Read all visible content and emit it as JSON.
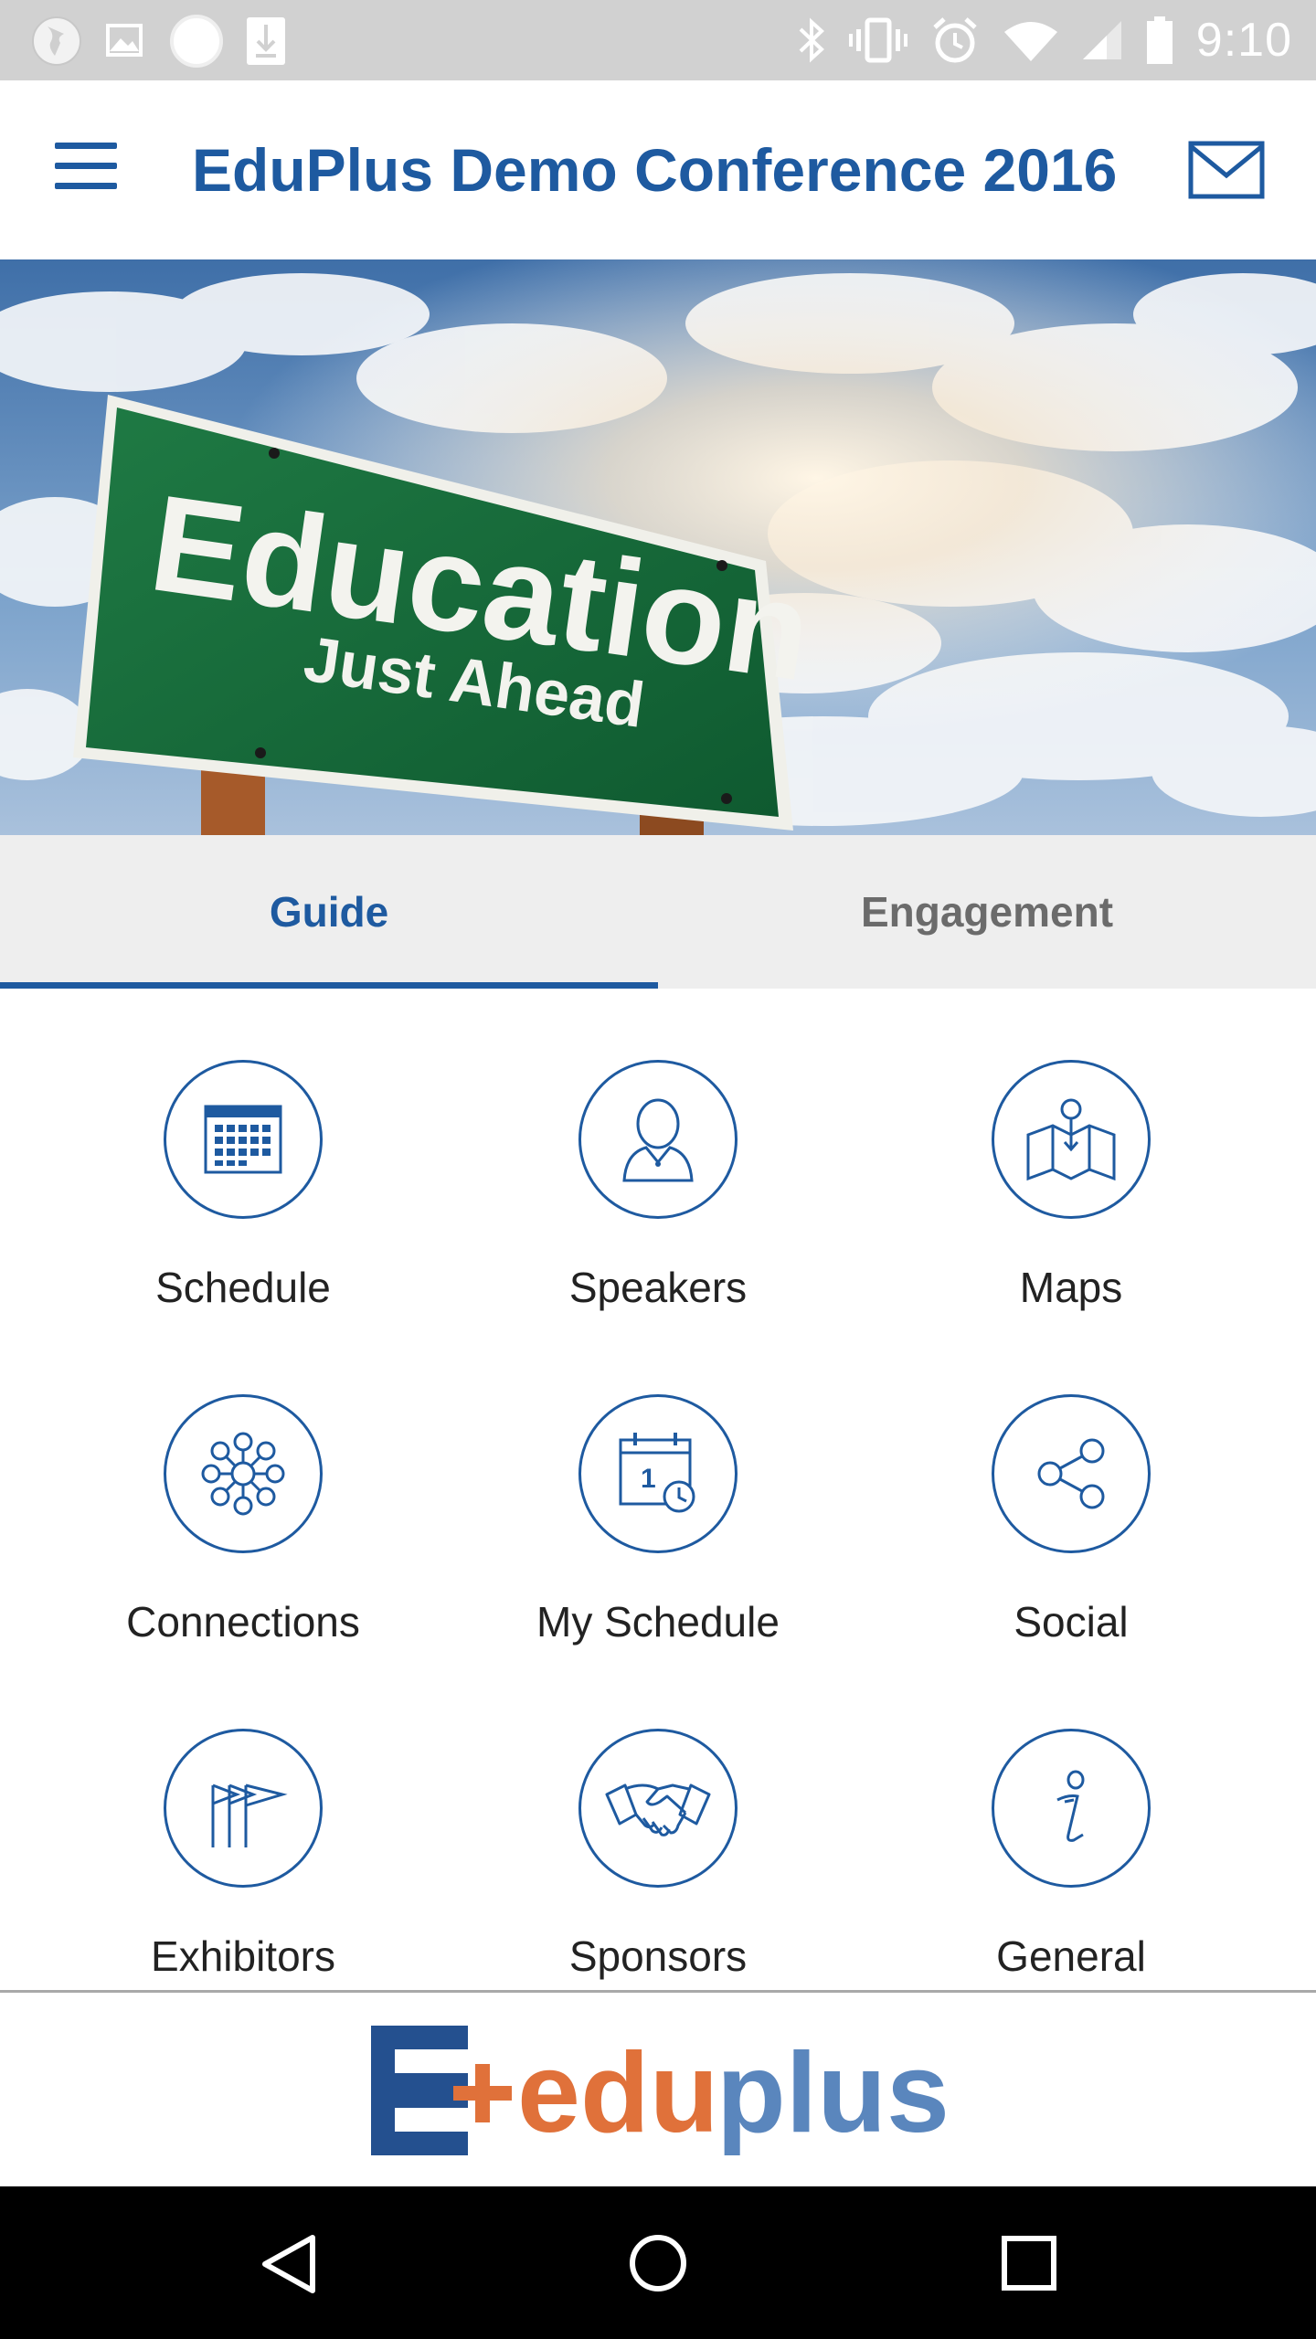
{
  "status_bar": {
    "time": "9:10",
    "left_icons": [
      "globe-icon",
      "image-icon",
      "circle-icon",
      "download-icon"
    ],
    "right_icons": [
      "bluetooth-icon",
      "vibrate-icon",
      "alarm-icon",
      "wifi-icon",
      "signal-icon",
      "battery-icon"
    ]
  },
  "app_bar": {
    "title": "EduPlus Demo Conference 2016",
    "menu_icon": "hamburger-menu-icon",
    "mail_icon": "mail-icon",
    "accent_color": "#1e5aa0"
  },
  "banner": {
    "sign_title": "Education",
    "sign_subtitle": "Just Ahead"
  },
  "tabs": [
    {
      "label": "Guide",
      "active": true
    },
    {
      "label": "Engagement",
      "active": false
    }
  ],
  "grid": {
    "items": [
      {
        "label": "Schedule",
        "icon": "calendar-icon"
      },
      {
        "label": "Speakers",
        "icon": "person-icon"
      },
      {
        "label": "Maps",
        "icon": "map-icon"
      },
      {
        "label": "Connections",
        "icon": "network-icon"
      },
      {
        "label": "My Schedule",
        "icon": "calendar-clock-icon"
      },
      {
        "label": "Social",
        "icon": "share-icon"
      },
      {
        "label": "Exhibitors",
        "icon": "flags-icon"
      },
      {
        "label": "Sponsors",
        "icon": "handshake-icon"
      },
      {
        "label": "General",
        "icon": "info-icon"
      }
    ]
  },
  "footer": {
    "logo_letter": "E",
    "logo_edu": "edu",
    "logo_plus": "plus",
    "logo_colors": {
      "blue": "#24508f",
      "orange": "#e0713a",
      "light_blue": "#5a86bd"
    }
  },
  "nav_bar": {
    "icons": [
      "back-icon",
      "home-icon",
      "recents-icon"
    ]
  }
}
